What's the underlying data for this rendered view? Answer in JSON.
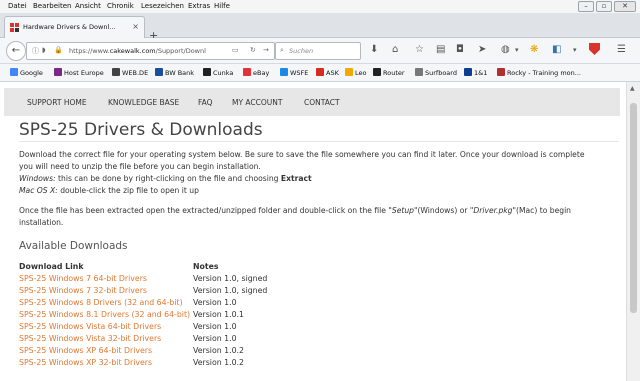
{
  "menu": [
    "Datei",
    "Bearbeiten",
    "Ansicht",
    "Chronik",
    "Lesezeichen",
    "Extras",
    "Hilfe"
  ],
  "tab": {
    "title": "Hardware Drivers & Downl...",
    "close": "×",
    "new": "+"
  },
  "urlbar": {
    "url_prefix": "https://www.",
    "url_domain": "cakewalk.com",
    "url_path": "/Support/Downl"
  },
  "search": {
    "placeholder": "Suchen"
  },
  "bookmarks": [
    {
      "label": "Google",
      "color": "#4285f4"
    },
    {
      "label": "Host Europe",
      "color": "#7a2a86"
    },
    {
      "label": "WEB.DE",
      "color": "#444444"
    },
    {
      "label": "BW Bank",
      "color": "#1b4f9c"
    },
    {
      "label": "Cunka",
      "color": "#222222"
    },
    {
      "label": "eBay",
      "color": "#e53238"
    },
    {
      "label": "WSFE",
      "color": "#1e88e5"
    },
    {
      "label": "ASK",
      "color": "#d62d20"
    },
    {
      "label": "Leo",
      "color": "#f2a900"
    },
    {
      "label": "Router",
      "color": "#222222"
    },
    {
      "label": "Surfboard",
      "color": "#777777"
    },
    {
      "label": "1&1",
      "color": "#0b3d91"
    },
    {
      "label": "Rocky - Training mon...",
      "color": "#b03030"
    }
  ],
  "site_nav": [
    "SUPPORT HOME",
    "KNOWLEDGE BASE",
    "FAQ",
    "MY ACCOUNT",
    "CONTACT"
  ],
  "page": {
    "title": "SPS-25 Drivers & Downloads",
    "intro_line1": "Download the correct file for your operating system below. Be sure to save the file somewhere you can find it later. Once your download is complete",
    "intro_line2": "you will need to unzip the file before you can begin installation.",
    "windows_label": "Windows:",
    "windows_text": " this can be done by right-clicking on the file and choosing ",
    "windows_action": "Extract",
    "mac_label": "Mac OS X:",
    "mac_text": " double-click the zip file to open it up",
    "extract_line1_a": "Once the file has been extracted open the extracted/unzipped folder and double-click on the file ",
    "setup_file": "\"Setup\"",
    "extract_line1_b": "(Windows) or ",
    "driver_file": "\"Driver.pkg\"",
    "extract_line1_c": "(Mac) to begin",
    "extract_line2": "installation.",
    "downloads_heading": "Available Downloads",
    "col_link": "Download Link",
    "col_notes": "Notes",
    "downloads": [
      {
        "link": "SPS-25 Windows 7 64-bit Drivers",
        "note": "Version 1.0, signed"
      },
      {
        "link": "SPS-25 Windows 7 32-bit Drivers",
        "note": "Version 1.0, signed"
      },
      {
        "link": "SPS-25 Windows 8 Drivers (32 and 64-bit)",
        "note": "Version 1.0"
      },
      {
        "link": "SPS-25 Windows 8.1 Drivers (32 and 64-bit)",
        "note": "Version 1.0.1"
      },
      {
        "link": "SPS-25 Windows Vista 64-bit Drivers",
        "note": "Version 1.0"
      },
      {
        "link": "SPS-25 Windows Vista 32-bit Drivers",
        "note": "Version 1.0"
      },
      {
        "link": "SPS-25 Windows XP 64-bit Drivers",
        "note": "Version 1.0.2"
      },
      {
        "link": "SPS-25 Windows XP 32-bit Drivers",
        "note": "Version 1.0.2"
      }
    ]
  },
  "colors": {
    "link": "#e0782f",
    "nav_bg": "#e7e7e7"
  }
}
